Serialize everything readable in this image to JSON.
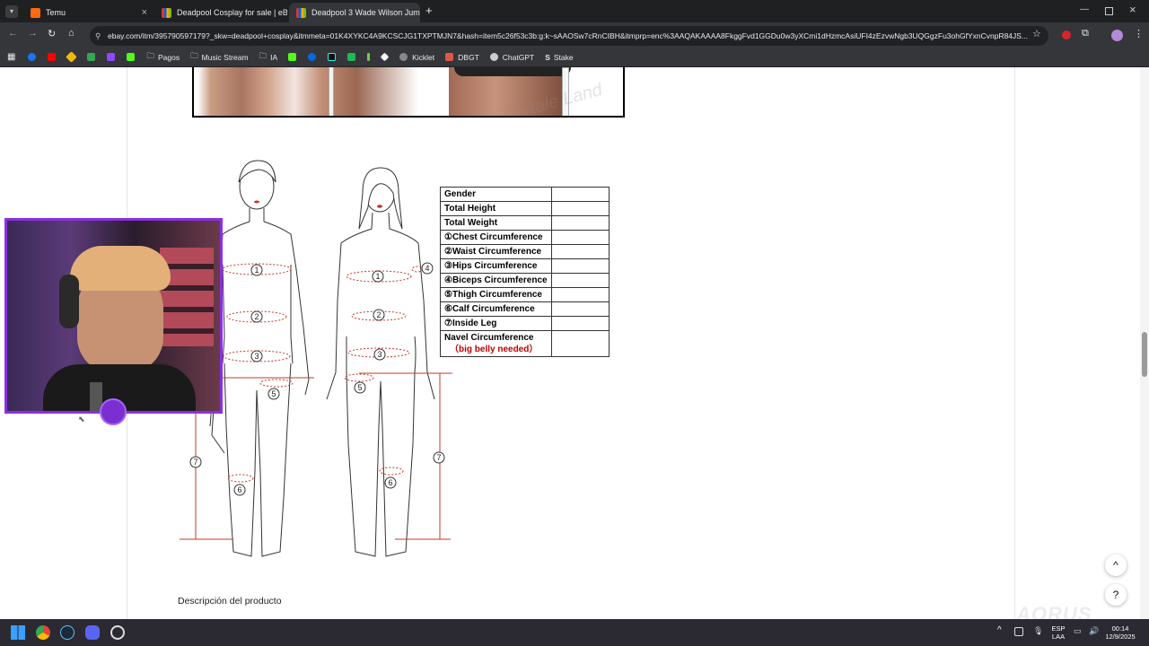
{
  "browser": {
    "tabs": [
      {
        "title": "Temu",
        "favicon_color": "#ff6a13"
      },
      {
        "title": "Deadpool Cosplay for sale | eB",
        "favicon_color": "#e53238"
      },
      {
        "title": "Deadpool 3 Wade Wilson Jump",
        "favicon_color": "#e53238"
      }
    ],
    "new_tab": "+",
    "url": "ebay.com/itm/395790597179?_skw=deadpool+cosplay&itmmeta=01K4XYKC4A9KCSCJG1TXPTMJN7&hash=item5c26f53c3b:g:k~sAAOSw7cRnCIBH&itmprp=enc%3AAQAKAAAA8FkggFvd1GGDu0w3yXCmi1dHzmcAsiUFI4zEzvwNgb3UQGgzFu3ohGfYxnCvnpR84JS...",
    "bookmarks": [
      "Pagos",
      "Music Stream",
      "IA",
      "Kicklet",
      "DBGT",
      "ChatGPT",
      "Stake"
    ]
  },
  "size_table": {
    "rows": [
      "Gender",
      "Total Height",
      "Total Weight",
      "①Chest Circumference",
      "②Waist Circumference",
      "③Hips Circumference",
      "④Biceps Circumference",
      "⑤Thigh Circumference",
      "⑥Calf Circumference",
      "⑦Inside Leg",
      "Navel Circumference"
    ],
    "note": "（big belly needed）"
  },
  "diagram_markers": {
    "m1": "1",
    "m2": "2",
    "m3": "3",
    "m4": "4",
    "m5": "5",
    "m6": "6",
    "m7": "7"
  },
  "product_description": "Descripción del producto",
  "floating": {
    "scroll_top": "^",
    "help": "?"
  },
  "watermark": "Fairytale Land",
  "taskbar": {
    "lang_top": "ESP",
    "lang_bottom": "LAA",
    "time": "00:14",
    "date": "12/9/2025",
    "brand": "AORUS"
  }
}
